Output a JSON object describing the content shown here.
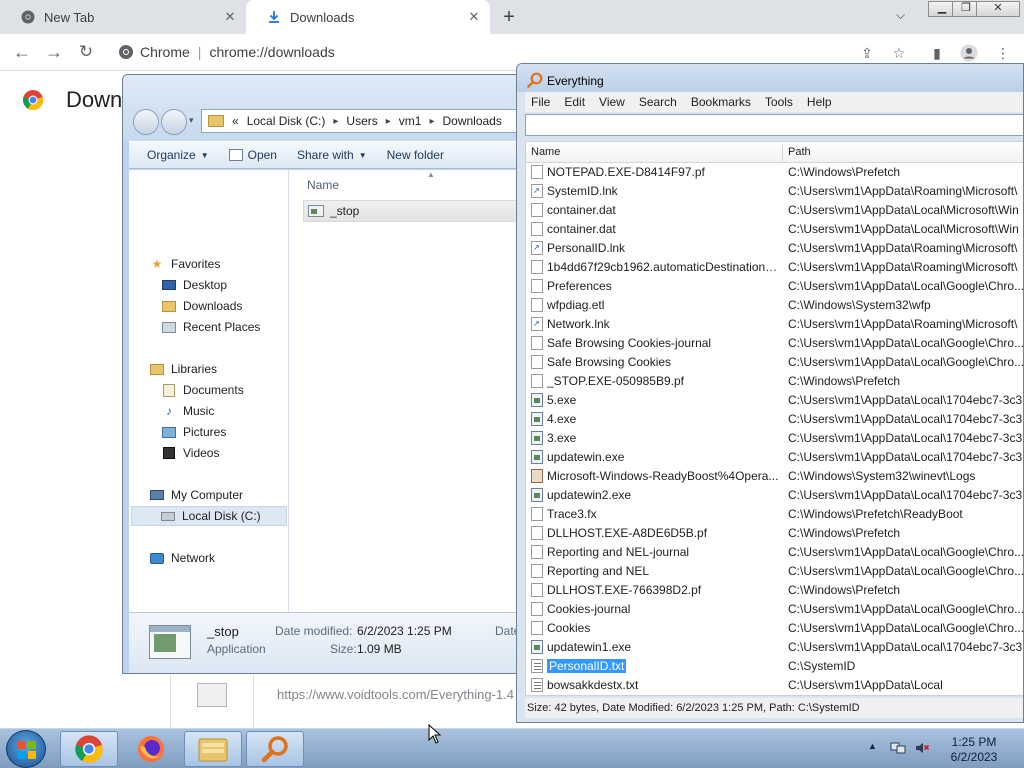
{
  "browser": {
    "tabs": [
      {
        "title": "New Tab"
      },
      {
        "title": "Downloads"
      }
    ],
    "omnibox": {
      "site": "Chrome",
      "url": "chrome://downloads"
    },
    "page_title": "Down",
    "download_url": "https://www.voidtools.com/Everything-1.4"
  },
  "explorer": {
    "breadcrumb": [
      "«",
      "Local Disk (C:)",
      "Users",
      "vm1",
      "Downloads"
    ],
    "commands": {
      "organize": "Organize",
      "open": "Open",
      "share": "Share with",
      "new_folder": "New folder"
    },
    "nav": {
      "favorites": "Favorites",
      "desktop": "Desktop",
      "downloads": "Downloads",
      "recent": "Recent Places",
      "libraries": "Libraries",
      "documents": "Documents",
      "music": "Music",
      "pictures": "Pictures",
      "videos": "Videos",
      "computer": "My Computer",
      "local_disk": "Local Disk (C:)",
      "network": "Network"
    },
    "column_name": "Name",
    "file": "_stop",
    "details": {
      "name": "_stop",
      "type": "Application",
      "date_label": "Date modified:",
      "date_value": "6/2/2023 1:25 PM",
      "size_label": "Size:",
      "size_value": "1.09 MB",
      "date_trunc": "Date"
    }
  },
  "everything": {
    "title": "Everything",
    "menu": [
      "File",
      "Edit",
      "View",
      "Search",
      "Bookmarks",
      "Tools",
      "Help"
    ],
    "columns": {
      "name": "Name",
      "path": "Path"
    },
    "rows": [
      {
        "name": "NOTEPAD.EXE-D8414F97.pf",
        "path": "C:\\Windows\\Prefetch",
        "icon": "file"
      },
      {
        "name": "SystemID.lnk",
        "path": "C:\\Users\\vm1\\AppData\\Roaming\\Microsoft\\",
        "icon": "lnk"
      },
      {
        "name": "container.dat",
        "path": "C:\\Users\\vm1\\AppData\\Local\\Microsoft\\Win",
        "icon": "file"
      },
      {
        "name": "container.dat",
        "path": "C:\\Users\\vm1\\AppData\\Local\\Microsoft\\Win",
        "icon": "file"
      },
      {
        "name": "PersonalID.lnk",
        "path": "C:\\Users\\vm1\\AppData\\Roaming\\Microsoft\\",
        "icon": "lnk"
      },
      {
        "name": "1b4dd67f29cb1962.automaticDestinations...",
        "path": "C:\\Users\\vm1\\AppData\\Roaming\\Microsoft\\",
        "icon": "file"
      },
      {
        "name": "Preferences",
        "path": "C:\\Users\\vm1\\AppData\\Local\\Google\\Chro...",
        "icon": "file"
      },
      {
        "name": "wfpdiag.etl",
        "path": "C:\\Windows\\System32\\wfp",
        "icon": "file"
      },
      {
        "name": "Network.lnk",
        "path": "C:\\Users\\vm1\\AppData\\Roaming\\Microsoft\\",
        "icon": "lnk"
      },
      {
        "name": "Safe Browsing Cookies-journal",
        "path": "C:\\Users\\vm1\\AppData\\Local\\Google\\Chro...",
        "icon": "file"
      },
      {
        "name": "Safe Browsing Cookies",
        "path": "C:\\Users\\vm1\\AppData\\Local\\Google\\Chro...",
        "icon": "file"
      },
      {
        "name": "_STOP.EXE-050985B9.pf",
        "path": "C:\\Windows\\Prefetch",
        "icon": "file"
      },
      {
        "name": "5.exe",
        "path": "C:\\Users\\vm1\\AppData\\Local\\1704ebc7-3c3...",
        "icon": "exe"
      },
      {
        "name": "4.exe",
        "path": "C:\\Users\\vm1\\AppData\\Local\\1704ebc7-3c3...",
        "icon": "exe"
      },
      {
        "name": "3.exe",
        "path": "C:\\Users\\vm1\\AppData\\Local\\1704ebc7-3c3...",
        "icon": "exe"
      },
      {
        "name": "updatewin.exe",
        "path": "C:\\Users\\vm1\\AppData\\Local\\1704ebc7-3c3...",
        "icon": "exe"
      },
      {
        "name": "Microsoft-Windows-ReadyBoost%4Opera...",
        "path": "C:\\Windows\\System32\\winevt\\Logs",
        "icon": "log"
      },
      {
        "name": "updatewin2.exe",
        "path": "C:\\Users\\vm1\\AppData\\Local\\1704ebc7-3c3...",
        "icon": "exe"
      },
      {
        "name": "Trace3.fx",
        "path": "C:\\Windows\\Prefetch\\ReadyBoot",
        "icon": "file"
      },
      {
        "name": "DLLHOST.EXE-A8DE6D5B.pf",
        "path": "C:\\Windows\\Prefetch",
        "icon": "file"
      },
      {
        "name": "Reporting and NEL-journal",
        "path": "C:\\Users\\vm1\\AppData\\Local\\Google\\Chro...",
        "icon": "file"
      },
      {
        "name": "Reporting and NEL",
        "path": "C:\\Users\\vm1\\AppData\\Local\\Google\\Chro...",
        "icon": "file"
      },
      {
        "name": "DLLHOST.EXE-766398D2.pf",
        "path": "C:\\Windows\\Prefetch",
        "icon": "file"
      },
      {
        "name": "Cookies-journal",
        "path": "C:\\Users\\vm1\\AppData\\Local\\Google\\Chro...",
        "icon": "file"
      },
      {
        "name": "Cookies",
        "path": "C:\\Users\\vm1\\AppData\\Local\\Google\\Chro...",
        "icon": "file"
      },
      {
        "name": "updatewin1.exe",
        "path": "C:\\Users\\vm1\\AppData\\Local\\1704ebc7-3c3...",
        "icon": "exe"
      },
      {
        "name": "PersonalID.txt",
        "path": "C:\\SystemID",
        "icon": "txt",
        "selected": true
      },
      {
        "name": "bowsakkdestx.txt",
        "path": "C:\\Users\\vm1\\AppData\\Local",
        "icon": "txt"
      }
    ],
    "status": "Size: 42 bytes, Date Modified: 6/2/2023 1:25 PM, Path: C:\\SystemID"
  },
  "taskbar": {
    "clock_time": "1:25 PM",
    "clock_date": "6/2/2023"
  },
  "colors": {
    "selection": "#3399ff",
    "taskbar": "#8fabcf"
  }
}
